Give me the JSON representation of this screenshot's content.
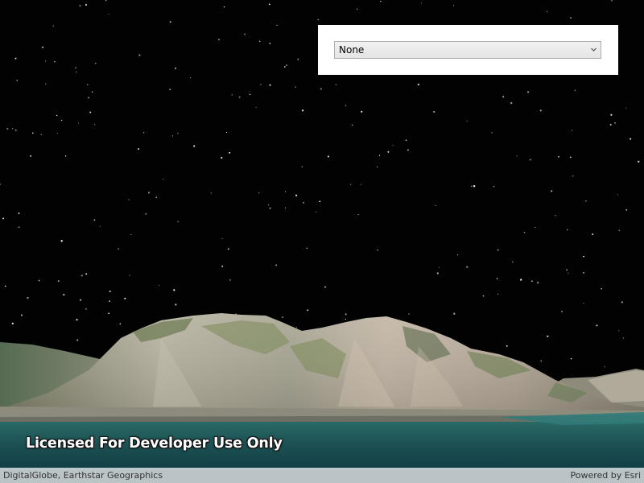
{
  "scene": {
    "sky_color": "#020202",
    "star_color": "#ffffff",
    "water_color": "#1e5a5a"
  },
  "control_panel": {
    "dropdown": {
      "selected": "None",
      "icon": "chevron-down-icon"
    }
  },
  "watermark": {
    "text": "Licensed For Developer Use Only"
  },
  "attribution": {
    "text": "DigitalGlobe, Earthstar Geographics",
    "powered_by": "Powered by Esri"
  }
}
